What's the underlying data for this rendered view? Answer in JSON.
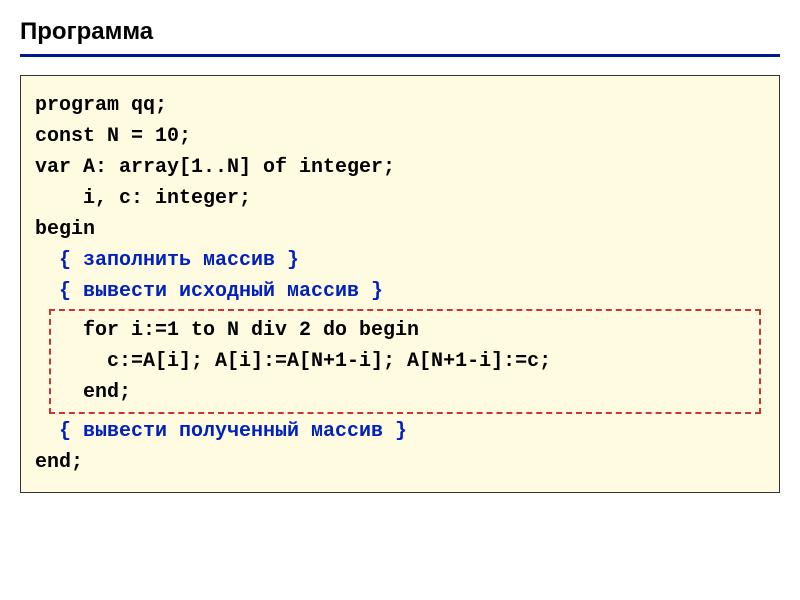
{
  "title": "Программа",
  "code": {
    "l1": "program qq;",
    "l2": "const N = 10;",
    "l3": "var A: array[1..N] of integer;",
    "l4": "    i, c: integer;",
    "l5": "begin",
    "l6": "  { заполнить массив }",
    "l7": "  { вывести исходный массив }",
    "l8": "  for i:=1 to N div 2 do begin",
    "l9": "    c:=A[i]; A[i]:=A[N+1-i]; A[N+1-i]:=c;",
    "l10": "  end;",
    "l11": "  { вывести полученный массив }",
    "l12": "end;"
  }
}
